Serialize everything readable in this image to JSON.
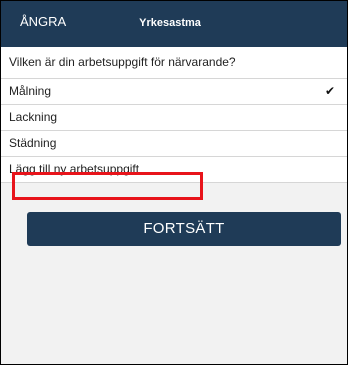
{
  "header": {
    "back_label": "ÅNGRA",
    "title": "Yrkesastma"
  },
  "question": "Vilken är din arbetsuppgift för närvarande?",
  "options": [
    {
      "label": "Målning",
      "selected": true
    },
    {
      "label": "Lackning",
      "selected": false
    },
    {
      "label": "Städning",
      "selected": false
    }
  ],
  "add_option_label": "Lägg till ny arbetsuppgift",
  "selected_icon": "checkmark-icon",
  "highlight_color": "#e8141b",
  "continue_label": "FORTSÄTT",
  "colors": {
    "primary": "#1f3b57",
    "background": "#f2f2f2"
  }
}
